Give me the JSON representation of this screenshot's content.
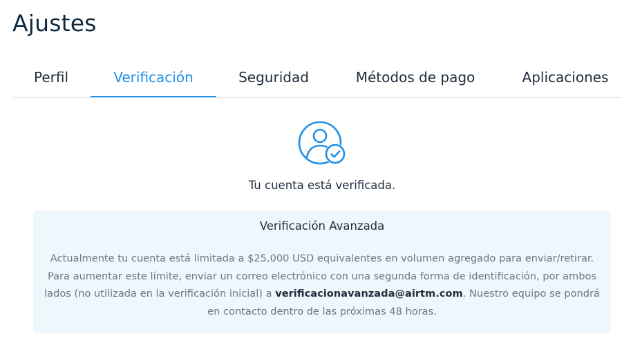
{
  "page": {
    "title": "Ajustes"
  },
  "tabs": [
    {
      "label": "Perfil",
      "active": false
    },
    {
      "label": "Verificación",
      "active": true
    },
    {
      "label": "Seguridad",
      "active": false
    },
    {
      "label": "Métodos de pago",
      "active": false
    },
    {
      "label": "Aplicaciones",
      "active": false
    }
  ],
  "verification": {
    "icon": "user-check-icon",
    "status_text": "Tu cuenta está verificada."
  },
  "advanced": {
    "title": "Verificación Avanzada",
    "body_before_email": "Actualmente tu cuenta está limitada a $25,000 USD equivalentes en volumen agregado para enviar/retirar. Para aumentar este límite, enviar un correo electrónico con una segunda forma de identificación, por ambos lados (no utilizada en la verificación inicial) a ",
    "email": "verificacionavanzada@airtm.com",
    "body_after_email": ". Nuestro equipo se pondrá en contacto dentro de las próximas 48 horas."
  },
  "colors": {
    "accent": "#1e90e8",
    "title": "#0f2a3f",
    "info_background": "#eef7fc",
    "muted_text": "#6e7681"
  }
}
